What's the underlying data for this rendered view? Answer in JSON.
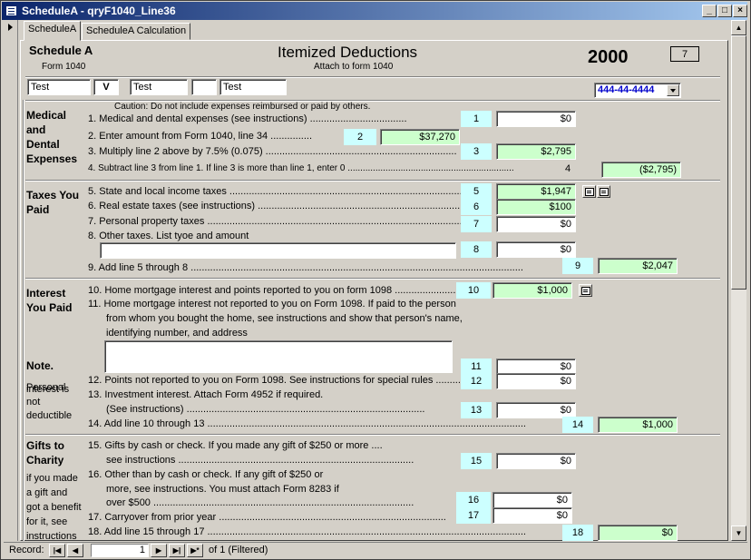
{
  "window": {
    "title": "ScheduleA - qryF1040_Line36"
  },
  "tabs": [
    {
      "label": "ScheduleA"
    },
    {
      "label": "ScheduleA Calculation"
    }
  ],
  "header": {
    "schedule": "Schedule A",
    "form": "Form 1040",
    "title": "Itemized Deductions",
    "attach": "Attach to form 1040",
    "year": "2000",
    "seq_box": "7",
    "name_fields": [
      "Test",
      "V",
      "Test",
      "",
      "Test"
    ],
    "ssn": "444-44-4444"
  },
  "medical": {
    "heading": [
      "Medical",
      "and",
      "Dental",
      "Expenses"
    ],
    "caution": "Caution: Do not include expenses reimbursed or paid by others.",
    "l1": {
      "text": "1. Medical and dental expenses (see instructions) ...................................",
      "num": "1",
      "value": "$0"
    },
    "l2": {
      "text": "2. Enter amount from Form 1040, line 34 ...............",
      "num": "2",
      "value": "$37,270"
    },
    "l3": {
      "text": "3. Multiply line 2 above by 7.5% (0.075) .....................................................................",
      "num": "3",
      "value": "$2,795"
    },
    "l4": {
      "text": "4. Subtract line 3 from line 1. If line 3 is more than line 1, enter 0 ..................................................................",
      "num": "4",
      "value": "($2,795)"
    }
  },
  "taxes": {
    "heading": [
      "Taxes You",
      "Paid"
    ],
    "l5": {
      "text": "5. State and local income taxes ..........................................................................................",
      "num": "5",
      "value": "$1,947"
    },
    "l6": {
      "text": "6. Real estate taxes (see instructions) ...............................................................................",
      "num": "6",
      "value": "$100"
    },
    "l7": {
      "text": "7. Personal property taxes ..................................................................................................",
      "num": "7",
      "value": "$0"
    },
    "l8": {
      "text": "8. Other taxes. List tyoe and amount",
      "num": "8",
      "value": "$0",
      "desc": ""
    },
    "l9": {
      "text": "9. Add line 5 through 8 ........................................................................................................................",
      "num": "9",
      "value": "$2,047"
    }
  },
  "interest": {
    "heading": [
      "Interest",
      "You Paid"
    ],
    "l10": {
      "text": "10. Home mortgage interest and points reported to you on form 1098 ..............................",
      "num": "10",
      "value": "$1,000"
    },
    "l11_lines": [
      "11. Home mortgage interest not reported to you on Form 1098. If paid to the person",
      "from whom you bought the home, see instructions and show that person's name,",
      "identifying number, and address"
    ],
    "l11": {
      "num": "11",
      "value": "$0",
      "desc": ""
    },
    "note_heading": "Note.",
    "note_lines": [
      "Personal",
      "interest is",
      "not",
      "deductible"
    ],
    "l12": {
      "text": "12. Points not reported to you on Form 1098. See instructions for special rules .........",
      "num": "12",
      "value": "$0"
    },
    "l13_lines": [
      "13. Investment interest. Attach Form 4952 if required.",
      "(See instructions) ......................................................................................"
    ],
    "l13": {
      "num": "13",
      "value": "$0"
    },
    "l14": {
      "text": "14. Add line 10 through 13 ...................................................................................................................",
      "num": "14",
      "value": "$1,000"
    }
  },
  "gifts": {
    "heading": [
      "Gifts to",
      "Charity"
    ],
    "note_lines": [
      "if you made",
      "a gift and",
      "got a benefit",
      "for it, see",
      "instructions"
    ],
    "l15_lines": [
      "15. Gifts by cash  or check. If you made any gift of $250 or more ....",
      "see instructions ....................................................................................."
    ],
    "l15": {
      "num": "15",
      "value": "$0"
    },
    "l16_lines": [
      "16. Other than by cash or check. If any gift of $250  or",
      "more, see instructions. You must attach Form 8283 if",
      "over $500 .............................................................................................."
    ],
    "l16": {
      "num": "16",
      "value": "$0"
    },
    "l17": {
      "text": "17. Carryover from prior year ..................................................................................",
      "num": "17",
      "value": "$0"
    },
    "l18": {
      "text": "18. Add line 15 through 17 ...................................................................................................................",
      "num": "18",
      "value": "$0"
    }
  },
  "navigation": {
    "record_label": "Record:",
    "current": "1",
    "of_text": "of  1 (Filtered)"
  }
}
